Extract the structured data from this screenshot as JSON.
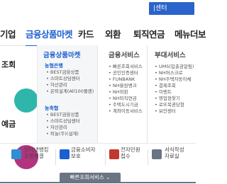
{
  "header": {
    "center_button": "|센터"
  },
  "gnb": {
    "items": [
      {
        "label": "기업",
        "active": false
      },
      {
        "label": "금융상품마켓",
        "active": true
      },
      {
        "label": "카드",
        "active": false
      },
      {
        "label": "외환",
        "active": false
      },
      {
        "label": "퇴직연금",
        "active": false
      },
      {
        "label": "메뉴더보",
        "active": false
      }
    ]
  },
  "left": {
    "label1": "조회",
    "label2": "예금"
  },
  "mega": {
    "col1": {
      "title": "금융상품마켓",
      "groups": [
        {
          "title": "농협은행",
          "items": [
            "BEST금융상품",
            "스마트상담센터",
            "자산관리",
            "은퇴설계(All100플랜)"
          ]
        },
        {
          "title": "농축협",
          "items": [
            "BEST금융상품",
            "스마트상담센터",
            "자산관리",
            "퇴놀(주)(설계)"
          ]
        }
      ]
    },
    "col2": {
      "title": "금융서비스",
      "items": [
        "빠른조회서비스",
        "공인인증센터",
        "FUNBANK",
        "NH올원뱅크",
        "NH외환",
        "NH퇴직연금",
        "주택도시기금",
        "계좌이동서비스"
      ]
    },
    "col3": {
      "title": "부대서비스",
      "items": [
        "UMS(입출금알림)",
        "NH머스크로",
        "NH주택자동이체",
        "결제조회",
        "이벤트",
        "영업점찾기",
        "로또복권당첨",
        "보안센터"
      ]
    }
  },
  "quick": [
    {
      "label": "인터넷뱅킹\n오류해결",
      "color": "#2f8fd4"
    },
    {
      "label": "금융소비자\n보호",
      "color": "#1c5fd0"
    },
    {
      "label": "전자민원\n접수",
      "color": "#c0392b"
    },
    {
      "label": "서식작성\n자료실",
      "color": "#6a7483"
    }
  ],
  "bottom": {
    "toggle_label": "빠른조회서비스 ⌄"
  },
  "colors": {
    "accent": "#1c5fd0",
    "teal": "#2fb6aa",
    "magenta": "#b2347e"
  }
}
